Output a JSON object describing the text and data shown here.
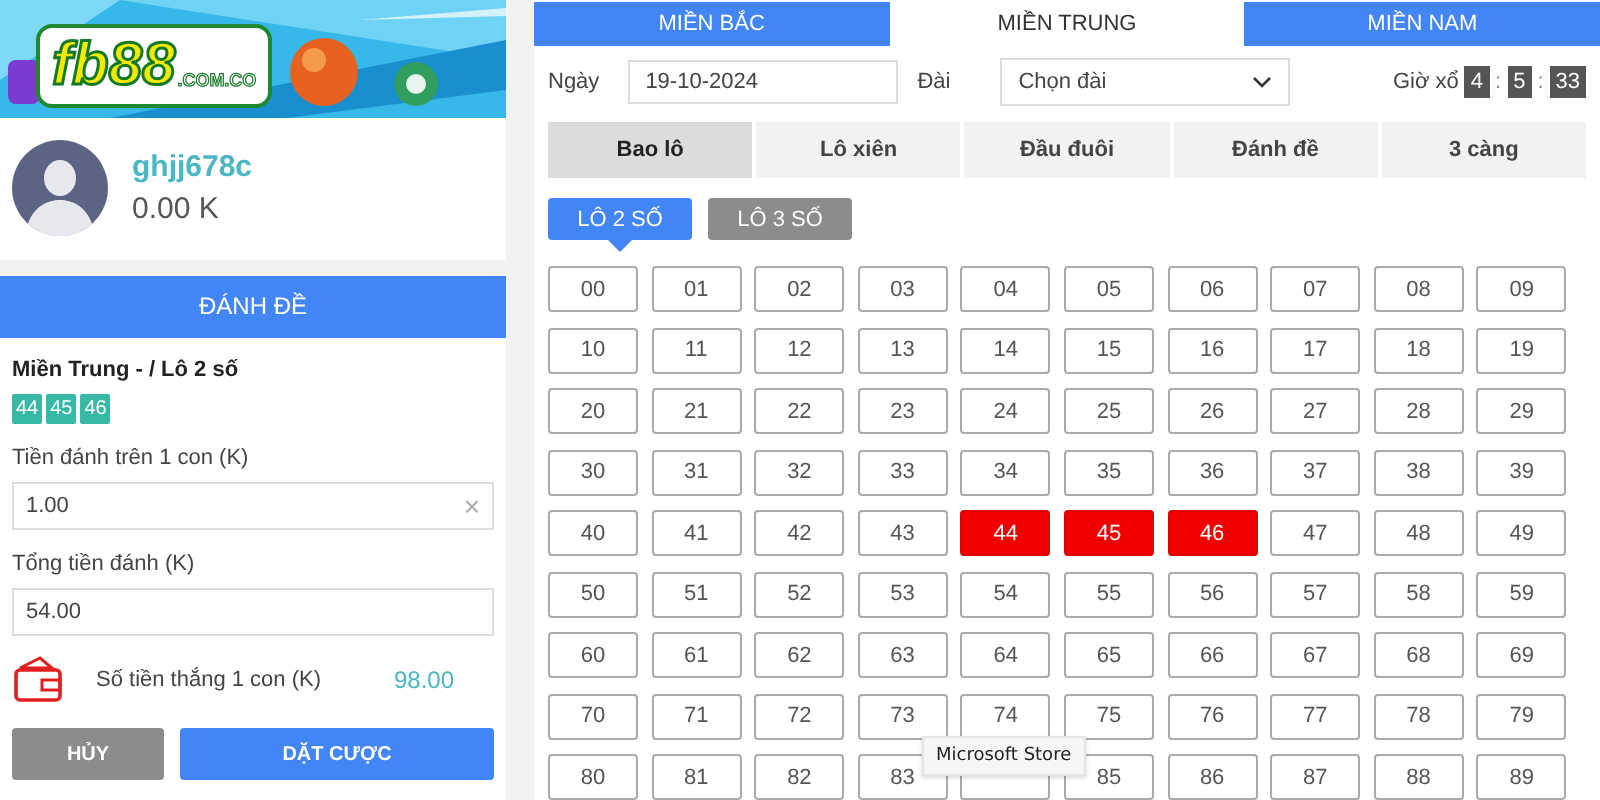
{
  "banner": {
    "logo": {
      "brand": "fb88",
      "suffix": ".COM.CO"
    }
  },
  "profile": {
    "username": "ghjj678c",
    "balance": "0.00 K"
  },
  "bet_panel": {
    "title": "ĐÁNH ĐỀ",
    "selection_title": "Miền Trung - / Lô 2 số",
    "chosen_numbers": [
      "44",
      "45",
      "46"
    ],
    "stake_label": "Tiền đánh trên 1 con (K)",
    "stake_value": "1.00",
    "clear_icon": "×",
    "total_label": "Tổng tiền đánh (K)",
    "total_value": "54.00",
    "win_label": "Số tiền thắng 1 con (K)",
    "win_value": "98.00",
    "buttons": [
      {
        "kind": "cancel",
        "label": "HỦY"
      },
      {
        "kind": "submit",
        "label": "DẶT CƯỢC"
      }
    ]
  },
  "region_tabs": [
    {
      "label": "MIỀN BẮC",
      "selected": false
    },
    {
      "label": "MIỀN TRUNG",
      "selected": true
    },
    {
      "label": "MIỀN NAM",
      "selected": false
    }
  ],
  "filters": {
    "date_label": "Ngày",
    "date_value": "19-10-2024",
    "station_label": "Đài",
    "station_value": "Chọn đài",
    "draw_label": "Giờ xổ",
    "countdown": [
      "4",
      "5",
      "33"
    ],
    "separator": ":"
  },
  "bet_types": [
    {
      "label": "Bao lô",
      "selected": true
    },
    {
      "label": "Lô xiên",
      "selected": false
    },
    {
      "label": "Đầu đuôi",
      "selected": false
    },
    {
      "label": "Đánh đề",
      "selected": false
    },
    {
      "label": "3 càng",
      "selected": false
    }
  ],
  "sub_types": [
    {
      "label": "LÔ 2 SỐ",
      "selected": true
    },
    {
      "label": "LÔ 3 SỐ",
      "selected": false
    }
  ],
  "numbers": [
    {
      "label": "00",
      "selected": false
    },
    {
      "label": "01",
      "selected": false
    },
    {
      "label": "02",
      "selected": false
    },
    {
      "label": "03",
      "selected": false
    },
    {
      "label": "04",
      "selected": false
    },
    {
      "label": "05",
      "selected": false
    },
    {
      "label": "06",
      "selected": false
    },
    {
      "label": "07",
      "selected": false
    },
    {
      "label": "08",
      "selected": false
    },
    {
      "label": "09",
      "selected": false
    },
    {
      "label": "10",
      "selected": false
    },
    {
      "label": "11",
      "selected": false
    },
    {
      "label": "12",
      "selected": false
    },
    {
      "label": "13",
      "selected": false
    },
    {
      "label": "14",
      "selected": false
    },
    {
      "label": "15",
      "selected": false
    },
    {
      "label": "16",
      "selected": false
    },
    {
      "label": "17",
      "selected": false
    },
    {
      "label": "18",
      "selected": false
    },
    {
      "label": "19",
      "selected": false
    },
    {
      "label": "20",
      "selected": false
    },
    {
      "label": "21",
      "selected": false
    },
    {
      "label": "22",
      "selected": false
    },
    {
      "label": "23",
      "selected": false
    },
    {
      "label": "24",
      "selected": false
    },
    {
      "label": "25",
      "selected": false
    },
    {
      "label": "26",
      "selected": false
    },
    {
      "label": "27",
      "selected": false
    },
    {
      "label": "28",
      "selected": false
    },
    {
      "label": "29",
      "selected": false
    },
    {
      "label": "30",
      "selected": false
    },
    {
      "label": "31",
      "selected": false
    },
    {
      "label": "32",
      "selected": false
    },
    {
      "label": "33",
      "selected": false
    },
    {
      "label": "34",
      "selected": false
    },
    {
      "label": "35",
      "selected": false
    },
    {
      "label": "36",
      "selected": false
    },
    {
      "label": "37",
      "selected": false
    },
    {
      "label": "38",
      "selected": false
    },
    {
      "label": "39",
      "selected": false
    },
    {
      "label": "40",
      "selected": false
    },
    {
      "label": "41",
      "selected": false
    },
    {
      "label": "42",
      "selected": false
    },
    {
      "label": "43",
      "selected": false
    },
    {
      "label": "44",
      "selected": true
    },
    {
      "label": "45",
      "selected": true
    },
    {
      "label": "46",
      "selected": true
    },
    {
      "label": "47",
      "selected": false
    },
    {
      "label": "48",
      "selected": false
    },
    {
      "label": "49",
      "selected": false
    },
    {
      "label": "50",
      "selected": false
    },
    {
      "label": "51",
      "selected": false
    },
    {
      "label": "52",
      "selected": false
    },
    {
      "label": "53",
      "selected": false
    },
    {
      "label": "54",
      "selected": false
    },
    {
      "label": "55",
      "selected": false
    },
    {
      "label": "56",
      "selected": false
    },
    {
      "label": "57",
      "selected": false
    },
    {
      "label": "58",
      "selected": false
    },
    {
      "label": "59",
      "selected": false
    },
    {
      "label": "60",
      "selected": false
    },
    {
      "label": "61",
      "selected": false
    },
    {
      "label": "62",
      "selected": false
    },
    {
      "label": "63",
      "selected": false
    },
    {
      "label": "64",
      "selected": false
    },
    {
      "label": "65",
      "selected": false
    },
    {
      "label": "66",
      "selected": false
    },
    {
      "label": "67",
      "selected": false
    },
    {
      "label": "68",
      "selected": false
    },
    {
      "label": "69",
      "selected": false
    },
    {
      "label": "70",
      "selected": false
    },
    {
      "label": "71",
      "selected": false
    },
    {
      "label": "72",
      "selected": false
    },
    {
      "label": "73",
      "selected": false
    },
    {
      "label": "74",
      "selected": false
    },
    {
      "label": "75",
      "selected": false
    },
    {
      "label": "76",
      "selected": false
    },
    {
      "label": "77",
      "selected": false
    },
    {
      "label": "78",
      "selected": false
    },
    {
      "label": "79",
      "selected": false
    },
    {
      "label": "80",
      "selected": false
    },
    {
      "label": "81",
      "selected": false
    },
    {
      "label": "82",
      "selected": false
    },
    {
      "label": "83",
      "selected": false
    },
    {
      "selected": false
    },
    {
      "label": "85",
      "selected": false
    },
    {
      "label": "86",
      "selected": false
    },
    {
      "label": "87",
      "selected": false
    },
    {
      "label": "88",
      "selected": false
    },
    {
      "label": "89",
      "selected": false
    }
  ],
  "tooltip": {
    "text": "Microsoft Store"
  }
}
